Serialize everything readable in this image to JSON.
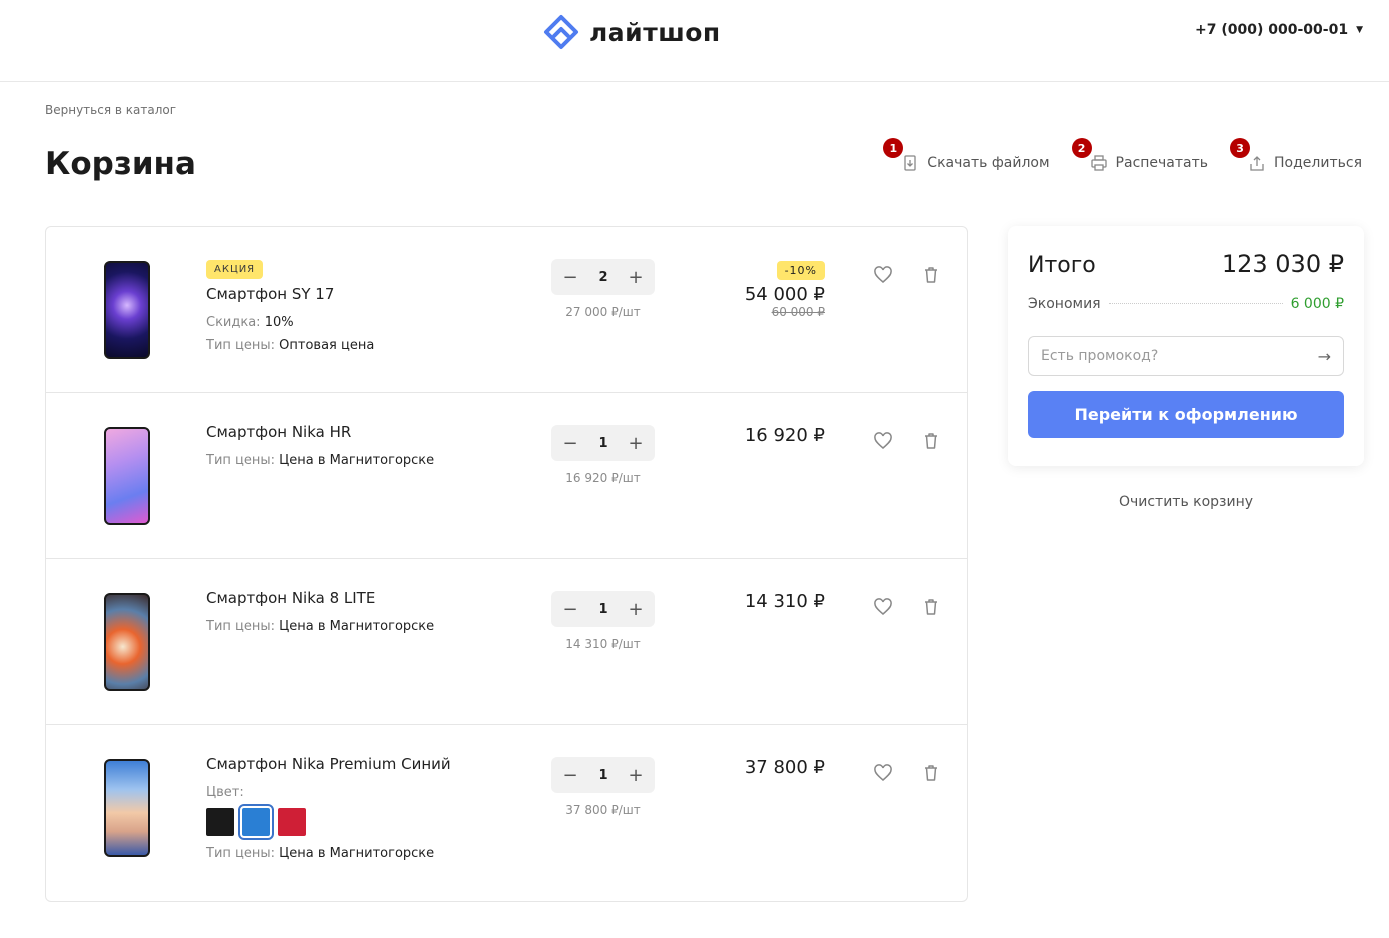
{
  "header": {
    "logo_text": "лайтшоп",
    "phone": "+7 (000) 000-00-01"
  },
  "nav": {
    "back_link": "Вернуться в каталог"
  },
  "page": {
    "title": "Корзина"
  },
  "actions": [
    {
      "badge": "1",
      "label": "Скачать файлом",
      "icon": "download-file-icon"
    },
    {
      "badge": "2",
      "label": "Распечатать",
      "icon": "print-icon"
    },
    {
      "badge": "3",
      "label": "Поделиться",
      "icon": "share-icon"
    }
  ],
  "colors": {
    "accent": "#5981f4",
    "badge": "#b50000",
    "tag": "#ffe56b",
    "economy": "#2f9e2f"
  },
  "cart": {
    "items": [
      {
        "promo_tag": "АКЦИЯ",
        "name": "Смартфон SY 17",
        "discount_label": "Скидка:",
        "discount_value": "10%",
        "price_type_label": "Тип цены:",
        "price_type_value": "Оптовая цена",
        "quantity": "2",
        "unit_price": "27 000 ₽/шт",
        "discount_tag": "-10%",
        "price": "54 000 ₽",
        "old_price": "60 000 ₽"
      },
      {
        "name": "Смартфон Nika HR",
        "price_type_label": "Тип цены:",
        "price_type_value": "Цена в Магнитогорске",
        "quantity": "1",
        "unit_price": "16 920 ₽/шт",
        "price": "16 920 ₽"
      },
      {
        "name": "Смартфон Nika 8 LITE",
        "price_type_label": "Тип цены:",
        "price_type_value": "Цена в Магнитогорске",
        "quantity": "1",
        "unit_price": "14 310 ₽/шт",
        "price": "14 310 ₽"
      },
      {
        "name": "Смартфон Nika Premium Синий",
        "color_label": "Цвет:",
        "colors": [
          "#1a1a1a",
          "#2a7fd4",
          "#cf1f36"
        ],
        "selected_color": 1,
        "price_type_label": "Тип цены:",
        "price_type_value": "Цена в Магнитогорске",
        "quantity": "1",
        "unit_price": "37 800 ₽/шт",
        "price": "37 800 ₽"
      }
    ]
  },
  "summary": {
    "title": "Итого",
    "total": "123 030 ₽",
    "economy_label": "Экономия",
    "economy_value": "6 000 ₽",
    "promo_placeholder": "Есть промокод?",
    "checkout_label": "Перейти к оформлению",
    "clear_label": "Очистить корзину"
  }
}
